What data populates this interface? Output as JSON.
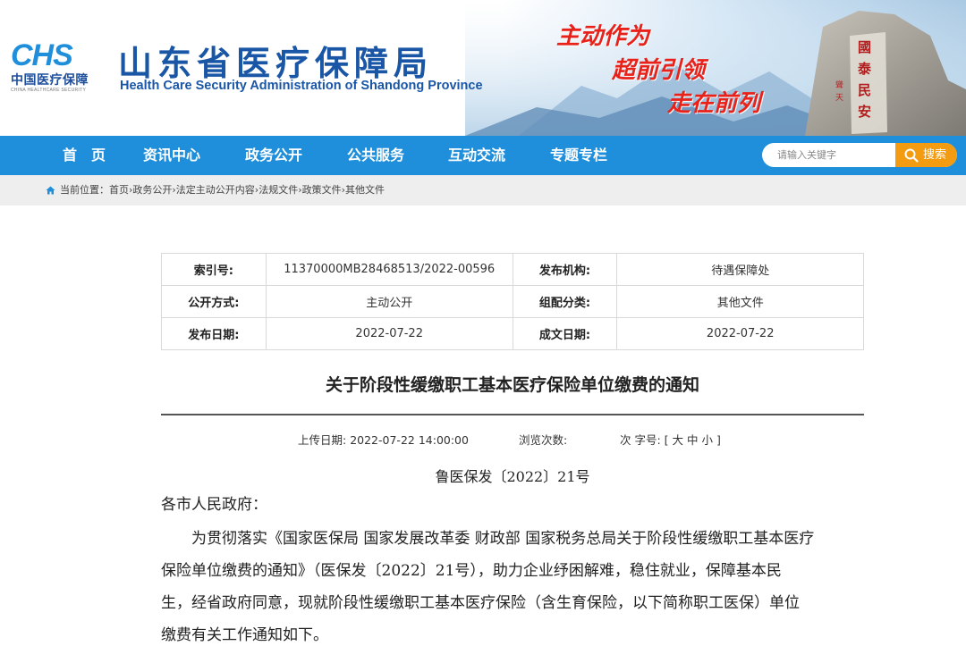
{
  "header": {
    "logo_mark": "CHS",
    "logo_cn": "中国医疗保障",
    "logo_en": "CHINA HEALTHCARE SECURITY",
    "title": "山东省医疗保障局",
    "subtitle": "Health Care Security Administration of Shandong Province",
    "slogans": [
      "主动作为",
      "超前引领",
      "走在前列"
    ],
    "colors": {
      "brand_blue": "#1a56a6",
      "slogan_red": "#e8221a"
    }
  },
  "nav": {
    "items": [
      {
        "label": "首　页"
      },
      {
        "label": "资讯中心"
      },
      {
        "label": "政务公开"
      },
      {
        "label": "公共服务"
      },
      {
        "label": "互动交流"
      },
      {
        "label": "专题专栏"
      }
    ],
    "search": {
      "placeholder": "请输入关键字",
      "button_label": "搜索",
      "icon": "search-icon"
    },
    "colors": {
      "bar": "#1f8fdb",
      "search_button": "#f39c12"
    }
  },
  "breadcrumb": {
    "icon": "home-icon",
    "text": "当前位置：首页›政务公开›法定主动公开内容›法规文件›政策文件›其他文件"
  },
  "meta": {
    "rows": [
      {
        "k1": "索引号:",
        "v1": "11370000MB28468513/2022-00596",
        "k2": "发布机构:",
        "v2": "待遇保障处"
      },
      {
        "k1": "公开方式:",
        "v1": "主动公开",
        "k2": "组配分类:",
        "v2": "其他文件"
      },
      {
        "k1": "发布日期:",
        "v1": "2022-07-22",
        "k2": "成文日期:",
        "v2": "2022-07-22"
      }
    ]
  },
  "article": {
    "title": "关于阶段性缓缴职工基本医疗保险单位缴费的通知",
    "upload_label": "上传日期:",
    "upload_value": "2022-07-22 14:00:00",
    "views_label": "浏览次数:",
    "font_size_label": "次 字号: [",
    "font_large": "大",
    "font_medium": "中",
    "font_small": "小",
    "font_size_end": "]",
    "doc_number": "鲁医保发〔2022〕21号",
    "greeting": "各市人民政府：",
    "paragraph_lines": [
      "　　为贯彻落实《国家医保局 国家发展改革委 财政部 国家税务总局关于阶段性缓缴职工基本医疗",
      "保险单位缴费的通知》（医保发〔2022〕21号），助力企业纾困解难，稳住就业，保障基本民",
      "生，经省政府同意，现就阶段性缓缴职工基本医疗保险（含生育保险，以下简称职工医保）单位",
      "缴费有关工作通知如下。"
    ]
  }
}
